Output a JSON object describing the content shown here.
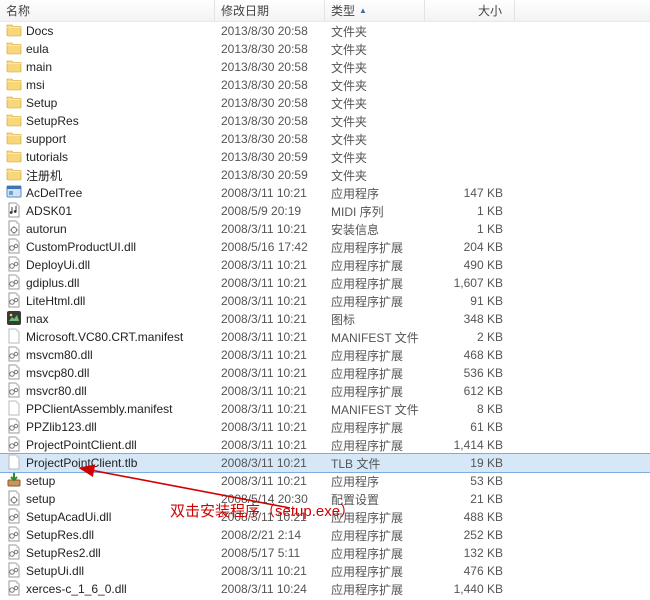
{
  "columns": {
    "name": "名称",
    "date": "修改日期",
    "type": "类型",
    "size": "大小"
  },
  "annotation_text": "双击安装程序（setup.exe）",
  "selected_index": 24,
  "rows": [
    {
      "icon": "folder",
      "name": "Docs",
      "date": "2013/8/30 20:58",
      "type": "文件夹",
      "size": ""
    },
    {
      "icon": "folder",
      "name": "eula",
      "date": "2013/8/30 20:58",
      "type": "文件夹",
      "size": ""
    },
    {
      "icon": "folder",
      "name": "main",
      "date": "2013/8/30 20:58",
      "type": "文件夹",
      "size": ""
    },
    {
      "icon": "folder",
      "name": "msi",
      "date": "2013/8/30 20:58",
      "type": "文件夹",
      "size": ""
    },
    {
      "icon": "folder",
      "name": "Setup",
      "date": "2013/8/30 20:58",
      "type": "文件夹",
      "size": ""
    },
    {
      "icon": "folder",
      "name": "SetupRes",
      "date": "2013/8/30 20:58",
      "type": "文件夹",
      "size": ""
    },
    {
      "icon": "folder",
      "name": "support",
      "date": "2013/8/30 20:58",
      "type": "文件夹",
      "size": ""
    },
    {
      "icon": "folder",
      "name": "tutorials",
      "date": "2013/8/30 20:59",
      "type": "文件夹",
      "size": ""
    },
    {
      "icon": "folder",
      "name": "注册机",
      "date": "2013/8/30 20:59",
      "type": "文件夹",
      "size": ""
    },
    {
      "icon": "exe",
      "name": "AcDelTree",
      "date": "2008/3/11 10:21",
      "type": "应用程序",
      "size": "147 KB"
    },
    {
      "icon": "midi",
      "name": "ADSK01",
      "date": "2008/5/9 20:19",
      "type": "MIDI 序列",
      "size": "1 KB"
    },
    {
      "icon": "inf",
      "name": "autorun",
      "date": "2008/3/11 10:21",
      "type": "安装信息",
      "size": "1 KB"
    },
    {
      "icon": "dll",
      "name": "CustomProductUI.dll",
      "date": "2008/5/16 17:42",
      "type": "应用程序扩展",
      "size": "204 KB"
    },
    {
      "icon": "dll",
      "name": "DeployUi.dll",
      "date": "2008/3/11 10:21",
      "type": "应用程序扩展",
      "size": "490 KB"
    },
    {
      "icon": "dll",
      "name": "gdiplus.dll",
      "date": "2008/3/11 10:21",
      "type": "应用程序扩展",
      "size": "1,607 KB"
    },
    {
      "icon": "dll",
      "name": "LiteHtml.dll",
      "date": "2008/3/11 10:21",
      "type": "应用程序扩展",
      "size": "91 KB"
    },
    {
      "icon": "ico",
      "name": "max",
      "date": "2008/3/11 10:21",
      "type": "图标",
      "size": "348 KB"
    },
    {
      "icon": "manifest",
      "name": "Microsoft.VC80.CRT.manifest",
      "date": "2008/3/11 10:21",
      "type": "MANIFEST 文件",
      "size": "2 KB"
    },
    {
      "icon": "dll",
      "name": "msvcm80.dll",
      "date": "2008/3/11 10:21",
      "type": "应用程序扩展",
      "size": "468 KB"
    },
    {
      "icon": "dll",
      "name": "msvcp80.dll",
      "date": "2008/3/11 10:21",
      "type": "应用程序扩展",
      "size": "536 KB"
    },
    {
      "icon": "dll",
      "name": "msvcr80.dll",
      "date": "2008/3/11 10:21",
      "type": "应用程序扩展",
      "size": "612 KB"
    },
    {
      "icon": "manifest",
      "name": "PPClientAssembly.manifest",
      "date": "2008/3/11 10:21",
      "type": "MANIFEST 文件",
      "size": "8 KB"
    },
    {
      "icon": "dll",
      "name": "PPZlib123.dll",
      "date": "2008/3/11 10:21",
      "type": "应用程序扩展",
      "size": "61 KB"
    },
    {
      "icon": "dll",
      "name": "ProjectPointClient.dll",
      "date": "2008/3/11 10:21",
      "type": "应用程序扩展",
      "size": "1,414 KB"
    },
    {
      "icon": "tlb",
      "name": "ProjectPointClient.tlb",
      "date": "2008/3/11 10:21",
      "type": "TLB 文件",
      "size": "19 KB"
    },
    {
      "icon": "installer",
      "name": "setup",
      "date": "2008/3/11 10:21",
      "type": "应用程序",
      "size": "53 KB"
    },
    {
      "icon": "ini",
      "name": "setup",
      "date": "2008/5/14 20:30",
      "type": "配置设置",
      "size": "21 KB"
    },
    {
      "icon": "dll",
      "name": "SetupAcadUi.dll",
      "date": "2008/3/11 10:21",
      "type": "应用程序扩展",
      "size": "488 KB"
    },
    {
      "icon": "dll",
      "name": "SetupRes.dll",
      "date": "2008/2/21 2:14",
      "type": "应用程序扩展",
      "size": "252 KB"
    },
    {
      "icon": "dll",
      "name": "SetupRes2.dll",
      "date": "2008/5/17 5:11",
      "type": "应用程序扩展",
      "size": "132 KB"
    },
    {
      "icon": "dll",
      "name": "SetupUi.dll",
      "date": "2008/3/11 10:21",
      "type": "应用程序扩展",
      "size": "476 KB"
    },
    {
      "icon": "dll",
      "name": "xerces-c_1_6_0.dll",
      "date": "2008/3/11 10:24",
      "type": "应用程序扩展",
      "size": "1,440 KB"
    }
  ]
}
